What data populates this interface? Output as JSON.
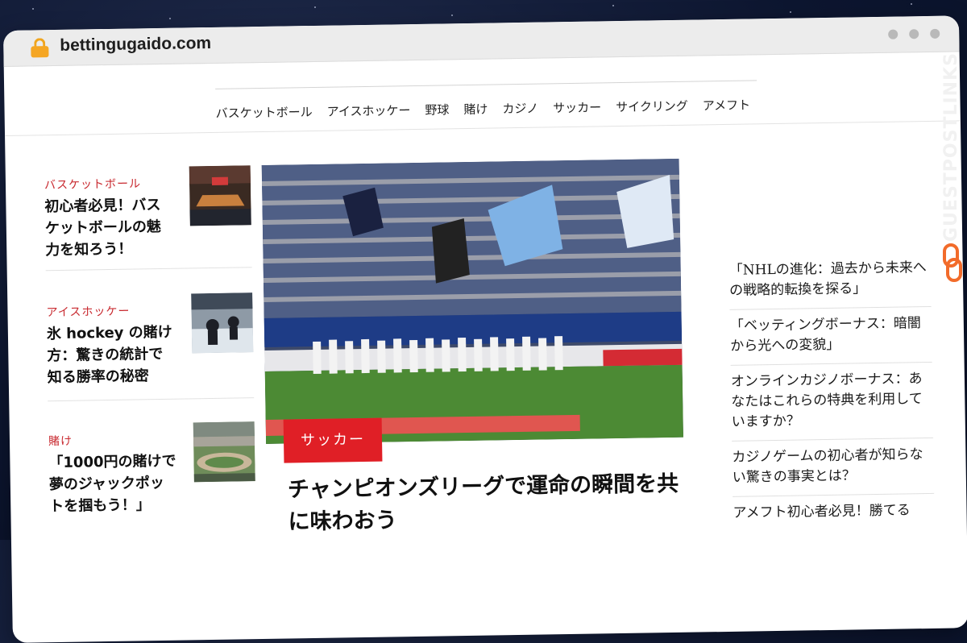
{
  "browser": {
    "url": "bettingugaido.com"
  },
  "nav": {
    "items": [
      "バスケットボール",
      "アイスホッケー",
      "野球",
      "賭け",
      "カジノ",
      "サッカー",
      "サイクリング",
      "アメフト"
    ]
  },
  "left_articles": [
    {
      "category": "バスケットボール",
      "title": "初心者必見！バスケットボールの魅力を知ろう！"
    },
    {
      "category": "アイスホッケー",
      "title": "氷 hockey の賭け方：驚きの統計で知る勝率の秘密"
    },
    {
      "category": "賭け",
      "title": "「1000円の賭けで夢のジャックポットを掴もう！」"
    }
  ],
  "featured": {
    "category": "サッカー",
    "title": "チャンピオンズリーグで運命の瞬間を共に味わおう"
  },
  "right_articles": [
    "「NHLの進化：過去から未来への戦略的転換を探る」",
    "「ベッティングボーナス：暗闇から光への変貌」",
    "オンラインカジノボーナス：あなたはこれらの特典を利用していますか？",
    "カジノゲームの初心者が知らない驚きの事実とは？",
    "アメフト初心者必見！勝てる"
  ],
  "watermark": "GUESTPOSTLINKS",
  "colors": {
    "accent_red": "#e01f26",
    "category_red": "#c8282e",
    "lock": "#f5a623",
    "watermark_orange": "#f26b2a"
  }
}
